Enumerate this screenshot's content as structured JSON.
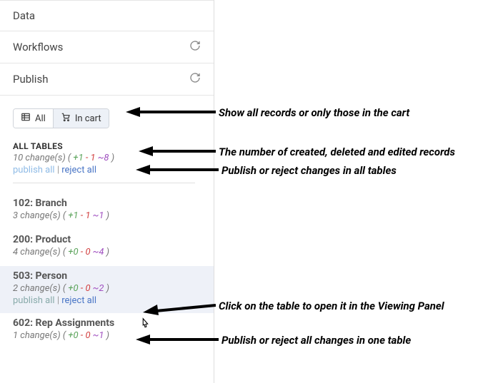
{
  "nav": {
    "data": "Data",
    "workflows": "Workflows",
    "publish": "Publish"
  },
  "filter": {
    "all": "All",
    "in_cart": "In cart"
  },
  "all_tables": {
    "title": "ALL TABLES",
    "count": "10 change(s)",
    "plus": "+1",
    "minus": "- 1",
    "tilde": "~8",
    "publish": "publish all",
    "reject": "reject all"
  },
  "tables": [
    {
      "title": "102: Branch",
      "count": "3 change(s)",
      "plus": "+1",
      "minus": "- 1",
      "tilde": "~1"
    },
    {
      "title": "200: Product",
      "count": "4 change(s)",
      "plus": "+0",
      "minus": "- 0",
      "tilde": "~4"
    },
    {
      "title": "503: Person",
      "count": "2 change(s)",
      "plus": "+0",
      "minus": "- 0",
      "tilde": "~2",
      "publish": "publish all",
      "reject": "reject all"
    },
    {
      "title": "602: Rep Assignments",
      "count": "1 change(s)",
      "plus": "+0",
      "minus": "- 0",
      "tilde": "~1"
    }
  ],
  "annotations": {
    "a1": "Show all records or only those in the cart",
    "a2": "The number of created, deleted and edited records",
    "a3": "Publish or reject changes in all tables",
    "a4": "Click on the table to open it in the Viewing Panel",
    "a5": "Publish or reject all changes in one table"
  }
}
